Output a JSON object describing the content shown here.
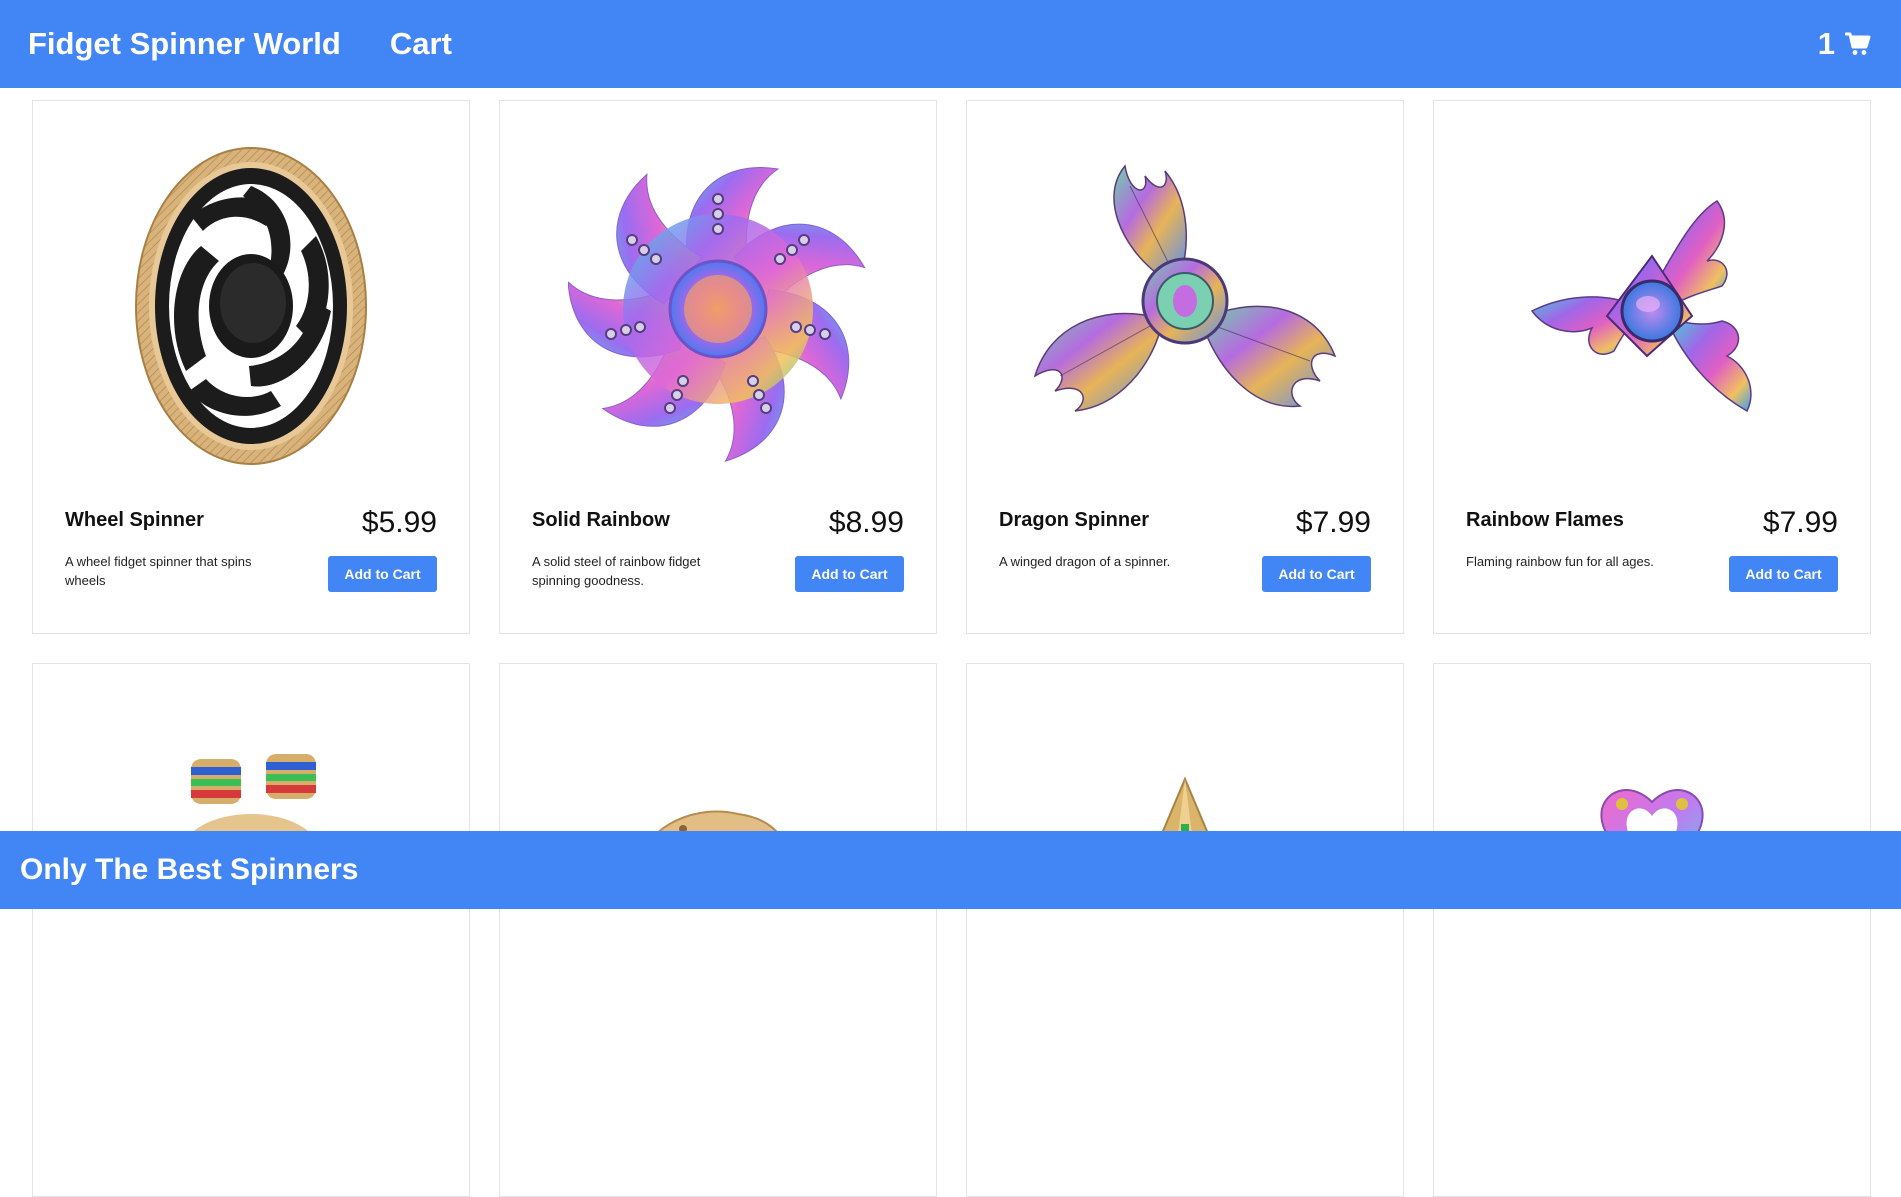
{
  "header": {
    "brand": "Fidget Spinner World",
    "nav_cart": "Cart",
    "cart_count": "1",
    "cart_icon": "shopping-cart-icon"
  },
  "products": [
    {
      "name": "Wheel Spinner",
      "price": "$5.99",
      "description": "A wheel fidget spinner that spins wheels",
      "button": "Add to Cart",
      "image": "wheel-spinner-image"
    },
    {
      "name": "Solid Rainbow",
      "price": "$8.99",
      "description": "A solid steel of rainbow fidget spinning goodness.",
      "button": "Add to Cart",
      "image": "solid-rainbow-image"
    },
    {
      "name": "Dragon Spinner",
      "price": "$7.99",
      "description": "A winged dragon of a spinner.",
      "button": "Add to Cart",
      "image": "dragon-spinner-image"
    },
    {
      "name": "Rainbow Flames",
      "price": "$7.99",
      "description": "Flaming rainbow fun for all ages.",
      "button": "Add to Cart",
      "image": "rainbow-flames-image"
    },
    {
      "image": "brass-color-ring-spinner-image"
    },
    {
      "image": "brass-spinner-image"
    },
    {
      "image": "gold-arrow-spinner-image"
    },
    {
      "image": "heart-spinner-image"
    }
  ],
  "footer": {
    "tagline": "Only The Best Spinners"
  },
  "colors": {
    "accent": "#4285f4",
    "card_border": "#e3e3e3"
  }
}
